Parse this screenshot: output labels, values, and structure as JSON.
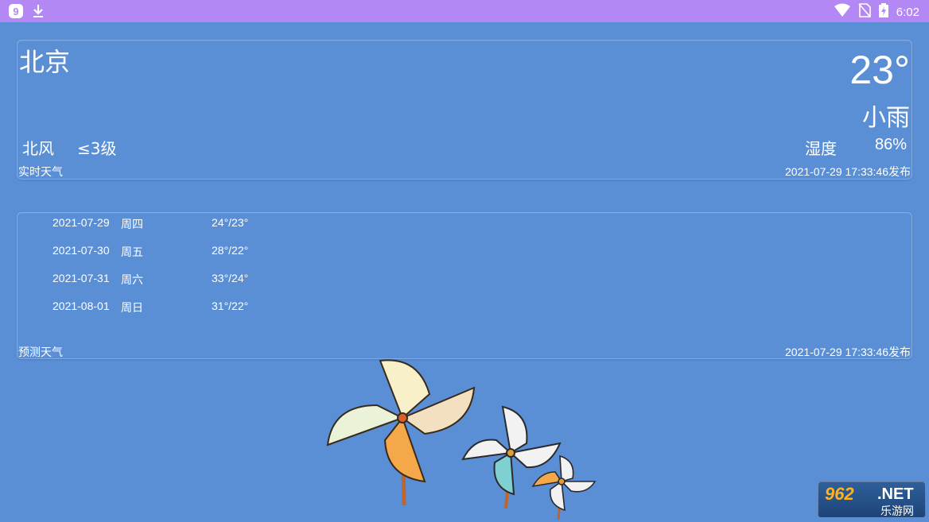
{
  "status_bar": {
    "time": "6:02",
    "icons": [
      "app-badge-icon",
      "download-icon",
      "wifi-icon",
      "no-sim-icon",
      "battery-charging-icon"
    ]
  },
  "realtime": {
    "city": "北京",
    "temperature": "23°",
    "condition": "小雨",
    "wind_direction": "北风",
    "wind_level": "≤3级",
    "humidity_label": "湿度",
    "humidity_value": "86%",
    "label": "实时天气",
    "published": "2021-07-29 17:33:46发布"
  },
  "forecast": {
    "days": [
      {
        "date": "2021-07-29",
        "weekday": "周四",
        "temp": "24°/23°"
      },
      {
        "date": "2021-07-30",
        "weekday": "周五",
        "temp": "28°/22°"
      },
      {
        "date": "2021-07-31",
        "weekday": "周六",
        "temp": "33°/24°"
      },
      {
        "date": "2021-08-01",
        "weekday": "周日",
        "temp": "31°/22°"
      }
    ],
    "label": "预测天气",
    "published": "2021-07-29 17:33:46发布"
  },
  "watermark": {
    "brand": "962",
    "domain": ".NET",
    "subtitle": "乐游网"
  },
  "colors": {
    "background": "#5a8fd6",
    "status_bar": "#b388f5"
  }
}
